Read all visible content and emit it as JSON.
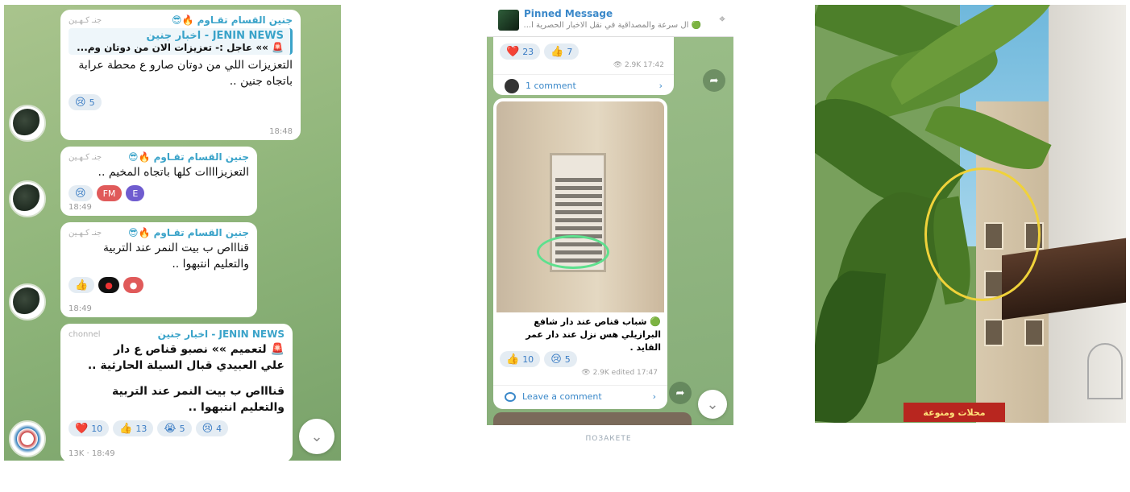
{
  "panel1": {
    "messages": [
      {
        "sender": "جنين القسام تقـاوم 🔥😎",
        "via": "جنـ كـهـين",
        "quote_title": "JENIN NEWS - اخبار جنين",
        "quote_text": "🚨 »» عاجل :- تعزيزات الان من دوتان وم...",
        "text": "التعزيزات اللي من دوتان صارو ع محطة عرابة باتجاه جنين ..",
        "reactions": [
          {
            "emoji": "😢",
            "count": "5"
          }
        ],
        "time": "18:48"
      },
      {
        "sender": "جنين القسام تقـاوم 🔥😎",
        "via": "جنـ كـهـين",
        "text": "التعزيزاااات كلها باتجاه المخيم ..",
        "reactions": [
          {
            "emoji": "😢",
            "count": ""
          },
          {
            "emoji": "FM",
            "count": ""
          },
          {
            "emoji": "E",
            "count": ""
          }
        ],
        "time": "18:49"
      },
      {
        "sender": "جنين القسام تقـاوم 🔥😎",
        "via": "جنـ كـهـين",
        "text": "قناااص ب بيت النمر عند التربية والتعليم انتبهوا ..",
        "reactions": [
          {
            "emoji": "👍",
            "count": ""
          },
          {
            "emoji": "●",
            "count": ""
          },
          {
            "emoji": "●",
            "count": ""
          }
        ],
        "time": "18:49"
      },
      {
        "sender": "JENIN NEWS - اخبار جنين",
        "via": "chonnel",
        "text_lines": [
          "🚨 لتعميم »» نصبو قناص ع دار",
          "علي العبيدي قبال السيلة الحارثية ..",
          "",
          "قناااص ب بيت النمر عند التربية",
          "والتعليم انتبهوا .."
        ],
        "reactions": [
          {
            "emoji": "❤️",
            "count": "10"
          },
          {
            "emoji": "👍",
            "count": "13"
          },
          {
            "emoji": "😭",
            "count": "5"
          },
          {
            "emoji": "😢",
            "count": "4"
          }
        ],
        "time": "13K · 18:49"
      }
    ],
    "scroll_icon": "chevron-down-icon",
    "scroll_glyph": "⌄"
  },
  "panel2": {
    "pinned_title": "Pinned Message",
    "pinned_text": "🟢 ال سرعة والمصداقية في نقل الاخبار الحصرية أ...",
    "top_reactions": [
      {
        "emoji": "❤️",
        "count": "23"
      },
      {
        "emoji": "👍",
        "count": "7"
      }
    ],
    "top_meta": "👁 2.9K  17:42",
    "comment_label": "1 comment",
    "post_text": "🟢 شباب قناص عند دار شافع البرازيلي هس نزل عند دار عمر القايد .",
    "post_reactions": [
      {
        "emoji": "👍",
        "count": "10"
      },
      {
        "emoji": "😢",
        "count": "5"
      }
    ],
    "post_meta": "👁 2.9K  edited 17:47",
    "leave_comment": "Leave a comment",
    "share_glyph": "➦",
    "chevron_right": "›",
    "scroll_glyph": "⌄",
    "pin_glyph": "⌖"
  },
  "panel3": {
    "sign_text": "محلات ومنوعة"
  },
  "caption": "ПОЗАКЕТЕ"
}
